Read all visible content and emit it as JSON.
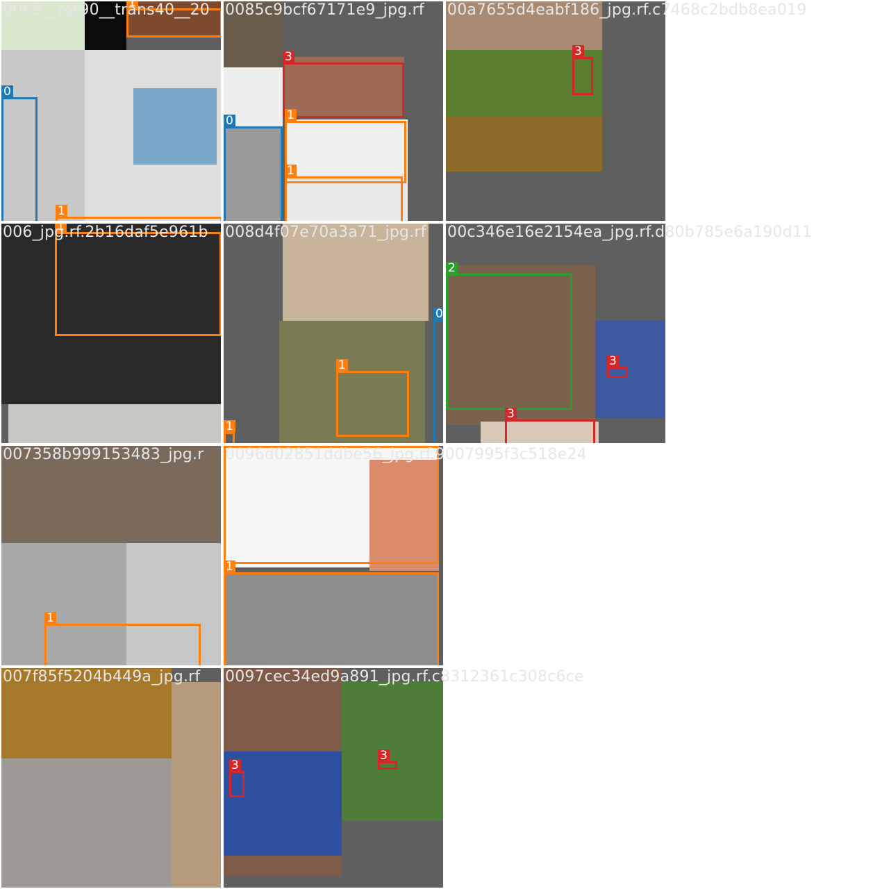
{
  "colors": {
    "0": "#1f77b4",
    "1": "#ff7f0e",
    "2": "#2ca02c",
    "3": "#d62728"
  },
  "filenames": [
    "0065__rot90__trans40__20",
    "0085c9bcf67171e9_jpg.rf",
    "00a7655d4eabf186_jpg.rf.c7468c2bdb8ea019",
    "006_jpg.rf.2b16daf5e961b",
    "008d4f07e70a3a71_jpg.rf",
    "00c346e16e2154ea_jpg.rf.d80b785e6a190d11",
    "007358b999153483_jpg.r",
    "0096d02851ddbe56_jpg.rf.9007995f3c518e24",
    "007f85f5204b449a_jpg.rf",
    "0097cec34ed9a891_jpg.rf.c8312361c308c6ce"
  ],
  "tiles": [
    {
      "regions": [
        {
          "color": "#d9e8cf"
        },
        {
          "color": "#0b0b0b"
        },
        {
          "color": "#7d4a30"
        },
        {
          "color": "#c8c8c8"
        },
        {
          "color": "#dedede"
        },
        {
          "color": "#7aa7c7"
        }
      ],
      "boxes": [
        {
          "cls": "0"
        },
        {
          "cls": "1"
        },
        {
          "cls": "1"
        }
      ]
    },
    {
      "regions": [
        {
          "color": "#6a5c4a"
        },
        {
          "color": "#eeeeee"
        },
        {
          "color": "#9c6a55"
        },
        {
          "color": "#9a9a9a"
        },
        {
          "color": "#efefef"
        },
        {
          "color": "#e9e9e9"
        }
      ],
      "boxes": [
        {
          "cls": "3"
        },
        {
          "cls": "0"
        },
        {
          "cls": "1"
        },
        {
          "cls": "1"
        }
      ]
    },
    {
      "regions": [
        {
          "color": "#a88972"
        },
        {
          "color": "#5a7d2e"
        },
        {
          "color": "#8c6a2a"
        }
      ],
      "boxes": [
        {
          "cls": "3"
        }
      ]
    },
    {
      "regions": [
        {
          "color": "#2a2a2a"
        },
        {
          "color": "#c9c9c4"
        }
      ],
      "boxes": [
        {
          "cls": "1"
        }
      ]
    },
    {
      "regions": [
        {
          "color": "#c8b49a"
        },
        {
          "color": "#7a7a55"
        }
      ],
      "boxes": [
        {
          "cls": "1"
        },
        {
          "cls": "0"
        },
        {
          "cls": "1"
        }
      ]
    },
    {
      "regions": [
        {
          "color": "#7a624f"
        },
        {
          "color": "#3d5aa0"
        },
        {
          "color": "#d7c8b8"
        }
      ],
      "boxes": [
        {
          "cls": "2"
        },
        {
          "cls": "3"
        },
        {
          "cls": "3"
        }
      ]
    },
    {
      "regions": [
        {
          "color": "#7a6a5c"
        },
        {
          "color": "#a9a9a9"
        },
        {
          "color": "#c5c6c8"
        }
      ],
      "boxes": [
        {
          "cls": "1"
        }
      ]
    },
    {
      "regions": [
        {
          "color": "#f6f6f6"
        },
        {
          "color": "#d98b6b"
        },
        {
          "color": "#8e8e8e"
        }
      ],
      "boxes": [
        {
          "cls": "1"
        },
        {
          "cls": "1"
        }
      ]
    },
    {
      "regions": [
        {
          "color": "#a6792a"
        },
        {
          "color": "#9d9a96"
        },
        {
          "color": "#b59b7b"
        }
      ],
      "boxes": []
    },
    {
      "regions": [
        {
          "color": "#7f5a48"
        },
        {
          "color": "#2f4fa0"
        },
        {
          "color": "#4e7d3a"
        }
      ],
      "boxes": [
        {
          "cls": "3"
        },
        {
          "cls": "3"
        }
      ]
    }
  ]
}
